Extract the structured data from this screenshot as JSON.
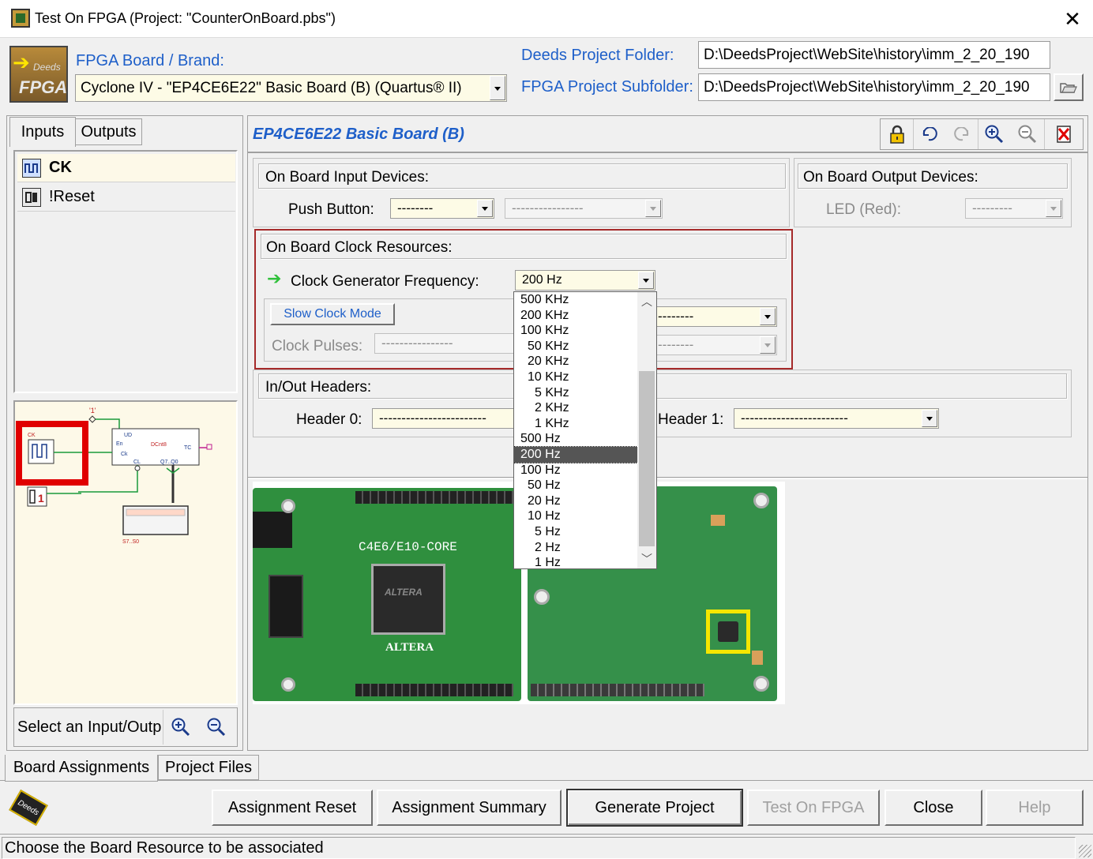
{
  "window": {
    "title": "Test On FPGA (Project: \"CounterOnBoard.pbs\")"
  },
  "header": {
    "board_brand_label": "FPGA Board / Brand:",
    "board_value": "Cyclone IV - \"EP4CE6E22\" Basic Board (B) (Quartus® II)",
    "project_folder_label": "Deeds Project Folder:",
    "project_folder_value": "D:\\DeedsProject\\WebSite\\history\\imm_2_20_190",
    "subfolder_label": "FPGA Project Subfolder:",
    "subfolder_value": "D:\\DeedsProject\\WebSite\\history\\imm_2_20_190",
    "logo_top": "Deeds",
    "logo_text": "FPGA"
  },
  "left_panel": {
    "tabs": [
      "Inputs",
      "Outputs"
    ],
    "items": [
      {
        "label": "CK"
      },
      {
        "label": "!Reset"
      }
    ],
    "status_text": "Select an Input/Outp"
  },
  "schematic": {
    "labels": {
      "one": "'1'",
      "ck": "CK",
      "ud": "UD",
      "en": "En",
      "ck_pin": "Ck",
      "tc": "TC",
      "dcnt": "DCnt8",
      "cl": "CL",
      "q": "Q7..Q0",
      "s": "S7..S0",
      "reset_glyph": "1"
    }
  },
  "board_panel": {
    "title": "EP4CE6E22 Basic Board (B)",
    "input_devices": {
      "title": "On Board Input Devices:",
      "push_button_label": "Push Button:",
      "push_button_value": "--------",
      "second_value": "----------------"
    },
    "output_devices": {
      "title": "On Board Output Devices:",
      "led_label": "LED (Red):",
      "led_value": "---------"
    },
    "clock": {
      "title": "On Board Clock Resources:",
      "freq_label": "Clock Generator Frequency:",
      "freq_value": "200 Hz",
      "slow_mode_label": "Slow Clock Mode",
      "pulses_label": "Clock Pulses:",
      "pulses_value": "----------------",
      "right_combo1_value": "--------",
      "right_combo2_value": "--------"
    },
    "headers": {
      "title": "In/Out Headers:",
      "header0_label": "Header 0:",
      "header0_value": "------------------------",
      "header1_label": "Header 1:",
      "header1_value": "------------------------"
    },
    "freq_dropdown": {
      "options": [
        "500 KHz",
        "200 KHz",
        "100 KHz",
        "50 KHz",
        "20 KHz",
        "10 KHz",
        "5 KHz",
        "2 KHz",
        "1 KHz",
        "500 Hz",
        "200 Hz",
        "100 Hz",
        "50 Hz",
        "20 Hz",
        "10 Hz",
        "5 Hz",
        "2 Hz",
        "1 Hz"
      ],
      "selected_index": 10
    },
    "board_photo": {
      "silkscreen": "C4E6/E10-CORE",
      "chip_brand": "ALTERA"
    }
  },
  "bottom": {
    "tabs": [
      "Board Assignments",
      "Project Files"
    ],
    "buttons": {
      "assignment_reset": "Assignment Reset",
      "assignment_summary": "Assignment Summary",
      "generate_project": "Generate Project",
      "test_on_fpga": "Test On FPGA",
      "close": "Close",
      "help": "Help"
    },
    "status_bar": "Choose the Board Resource to be associated",
    "logo_text": "Deeds"
  },
  "colors": {
    "accent_blue": "#1e5fc9",
    "highlight_red": "#a52a2a",
    "selection_red": "#e00000",
    "pcb_green": "#2f8f3e"
  }
}
